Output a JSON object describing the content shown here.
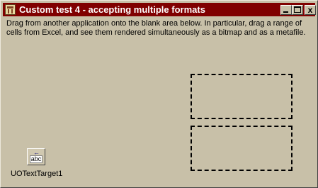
{
  "window": {
    "title": "Custom test 4 - accepting multiple formats",
    "close_glyph": "x"
  },
  "main": {
    "description": "Drag from another application onto the blank area below.  In particular, drag a range of cells from Excel, and see them rendered simultaneously as a bitmap and as a metafile."
  },
  "control": {
    "icon_text": "abc",
    "icon_arrow": "←",
    "label": "UOTextTarget1"
  }
}
